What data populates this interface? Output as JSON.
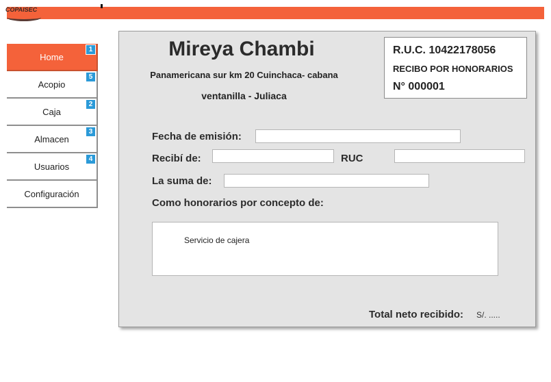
{
  "header": {
    "logo_text": "COPAISEC"
  },
  "sidebar": {
    "items": [
      {
        "label": "Home",
        "badge": "1",
        "active": true
      },
      {
        "label": "Acopio",
        "badge": "5"
      },
      {
        "label": "Caja",
        "badge": "2"
      },
      {
        "label": "Almacen",
        "badge": "3"
      },
      {
        "label": "Usuarios",
        "badge": "4"
      },
      {
        "label": "Configuración"
      }
    ]
  },
  "receipt": {
    "name": "Mireya Chambi",
    "address_line1": "Panamericana sur km 20 Cuinchaca- cabana",
    "address_line2": "ventanilla - Juliaca",
    "ruc_label": "R.U.C. 10422178056",
    "doc_type": "RECIBO POR HONORARIOS",
    "doc_number": "N° 000001",
    "fields": {
      "fecha_label": "Fecha de emisión:",
      "fecha_value": "",
      "recibi_label": "Recibí de:",
      "recibi_value": "",
      "ruc_field_label": "RUC",
      "ruc_field_value": "",
      "suma_label": "La suma de:",
      "suma_value": "",
      "concepto_label": "Como honorarios por concepto de:",
      "concepto_text": "Servicio de cajera"
    },
    "total_label": "Total neto recibido:",
    "total_value": "S/. ....."
  },
  "colors": {
    "brand_orange": "#f4623a",
    "badge_blue": "#2b9ad8",
    "panel_gray": "#e4e4e4"
  }
}
